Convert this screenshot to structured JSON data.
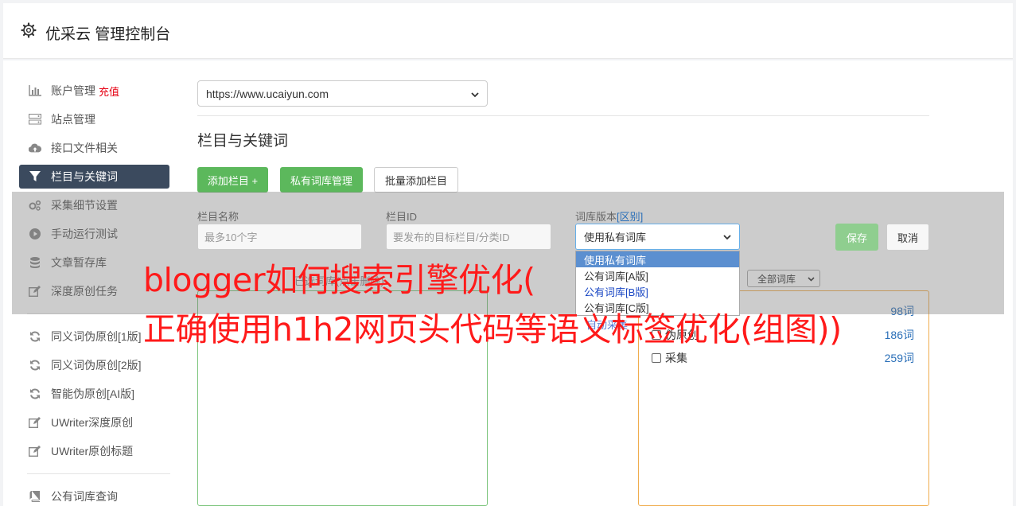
{
  "header": {
    "icon": "gear-icon",
    "title": "优采云 管理控制台"
  },
  "sidebar": {
    "items": [
      {
        "icon": "bar-chart-icon",
        "label": "账户管理",
        "extra": "充值"
      },
      {
        "icon": "server-icon",
        "label": "站点管理"
      },
      {
        "icon": "cloud-upload-icon",
        "label": "接口文件相关"
      },
      {
        "icon": "filter-icon",
        "label": "栏目与关键词",
        "active": true
      },
      {
        "icon": "cogs-icon",
        "label": "采集细节设置"
      },
      {
        "icon": "play-circle-icon",
        "label": "手动运行测试"
      },
      {
        "icon": "database-icon",
        "label": "文章暂存库"
      },
      {
        "icon": "edit-icon",
        "label": "深度原创任务"
      },
      {
        "icon": "refresh-icon",
        "label": "同义词伪原创[1版]"
      },
      {
        "icon": "refresh-icon",
        "label": "同义词伪原创[2版]"
      },
      {
        "icon": "refresh-icon",
        "label": "智能伪原创[AI版]"
      },
      {
        "icon": "edit-icon",
        "label": "UWriter深度原创"
      },
      {
        "icon": "edit-icon",
        "label": "UWriter原创标题"
      },
      {
        "icon": "book-icon",
        "label": "公有词库查询"
      }
    ]
  },
  "site_select": {
    "value": "https://www.ucaiyun.com"
  },
  "section_title": "栏目与关键词",
  "buttons": {
    "add_column": "添加栏目 +",
    "private_lib": "私有词库管理",
    "batch_add": "批量添加栏目",
    "save": "保存",
    "cancel": "取消"
  },
  "form": {
    "name_label": "栏目名称",
    "name_placeholder": "最多10个字",
    "id_label": "栏目ID",
    "id_placeholder": "要发布的目标栏目/分类ID",
    "lib_label": "词库版本",
    "lib_label_link": "[区别]",
    "lib_value": "使用私有词库",
    "lib_options": [
      "使用私有词库",
      "公有词库[A版]",
      "公有词库[B版]",
      "公有词库[C版]"
    ],
    "ghost_left": "已选词库(点击删除)",
    "ghost_dropdown": "自动采集"
  },
  "library_filter": {
    "value": "全部词库"
  },
  "library_list": [
    {
      "name": "",
      "count": "98词"
    },
    {
      "name": "伪原创",
      "count": "186词"
    },
    {
      "name": "采集",
      "count": "259词"
    }
  ],
  "watermark": {
    "line1": "blogger如何搜索引擎优化(",
    "line2": "正确使用h1h2网页头代码等语义标签优化(组图))"
  }
}
